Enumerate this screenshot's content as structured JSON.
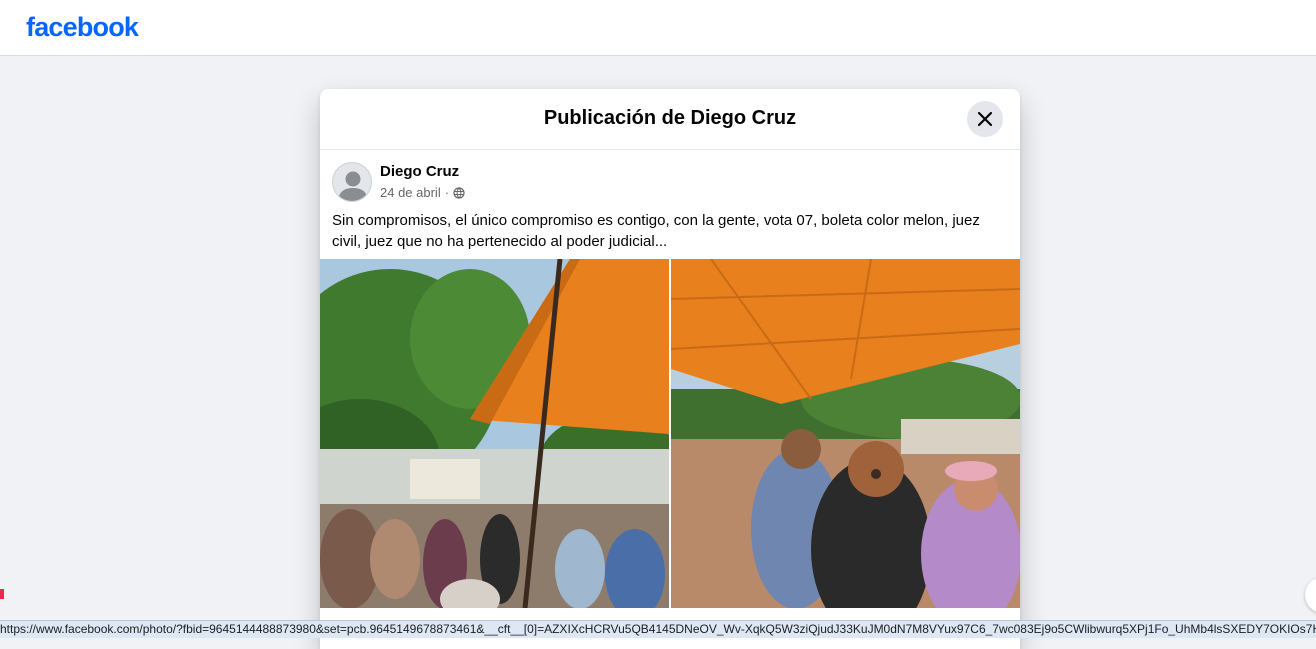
{
  "topbar": {
    "logo_text": "facebook"
  },
  "dialog": {
    "title": "Publicación de Diego Cruz",
    "close_icon": "close-icon"
  },
  "post": {
    "author": "Diego Cruz",
    "date": "24 de abril",
    "separator": "·",
    "privacy_icon": "globe-icon",
    "text": "Sin compromisos, el único compromiso es contigo, con la gente, vota 07, boleta color melon, juez civil, juez que no ha pertenecido al poder judicial..."
  },
  "statusbar": {
    "url": "https://www.facebook.com/photo/?fbid=9645144488873980&set=pcb.9645149678873461&__cft__[0]=AZXIXcHCRVu5QB4145DNeOV_Wv-XqkQ5W3ziQjudJ33KuJM0dN7M8VYux97C6_7wc083Ej9o5CWlibwurq5XPj1Fo_UhMb4lsSXEDY7OKIOs7HAaeKi"
  },
  "colors": {
    "brand": "#0866ff",
    "page_bg": "#f0f2f5",
    "canopy": "#e8801e"
  }
}
